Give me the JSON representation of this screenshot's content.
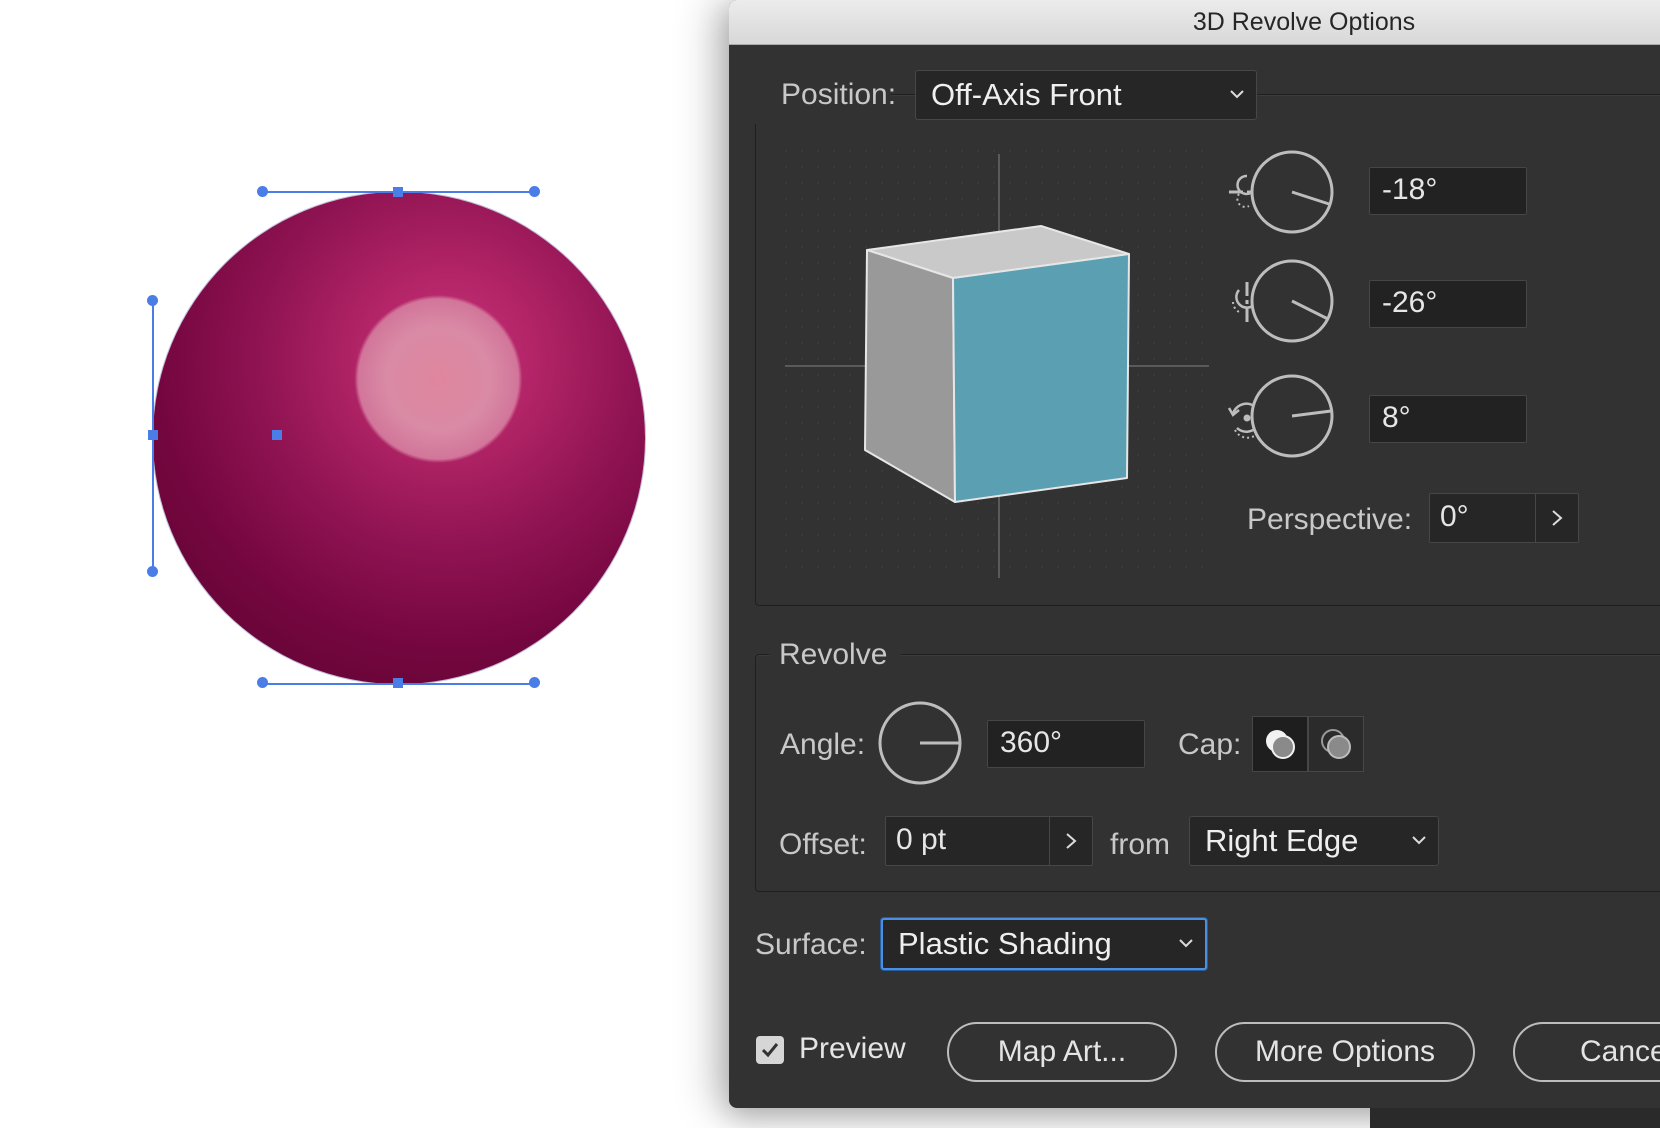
{
  "dialog": {
    "title": "3D Revolve Options",
    "position": {
      "label": "Position:",
      "value": "Off-Axis Front"
    },
    "rotation": {
      "x": {
        "value": "-18°"
      },
      "y": {
        "value": "-26°"
      },
      "z": {
        "value": "8°"
      }
    },
    "perspective": {
      "label": "Perspective:",
      "value": "0°"
    },
    "revolve": {
      "title": "Revolve",
      "angle_label": "Angle:",
      "angle_value": "360°",
      "cap_label": "Cap:",
      "offset_label": "Offset:",
      "offset_value": "0 pt",
      "from_label": "from",
      "from_value": "Right Edge"
    },
    "surface": {
      "label": "Surface:",
      "value": "Plastic Shading"
    },
    "preview": {
      "label": "Preview",
      "checked": true
    },
    "buttons": {
      "map_art": "Map Art...",
      "more_options": "More Options",
      "cancel": "Cance"
    }
  },
  "colors": {
    "dialog_bg": "#323232",
    "cube_front": "#5aa0b2",
    "cube_side": "#9a9a9a",
    "cube_top": "#c8c8c8",
    "sphere": "#8f1352",
    "selection": "#4a7de6",
    "focus_ring": "#4a90e2"
  }
}
